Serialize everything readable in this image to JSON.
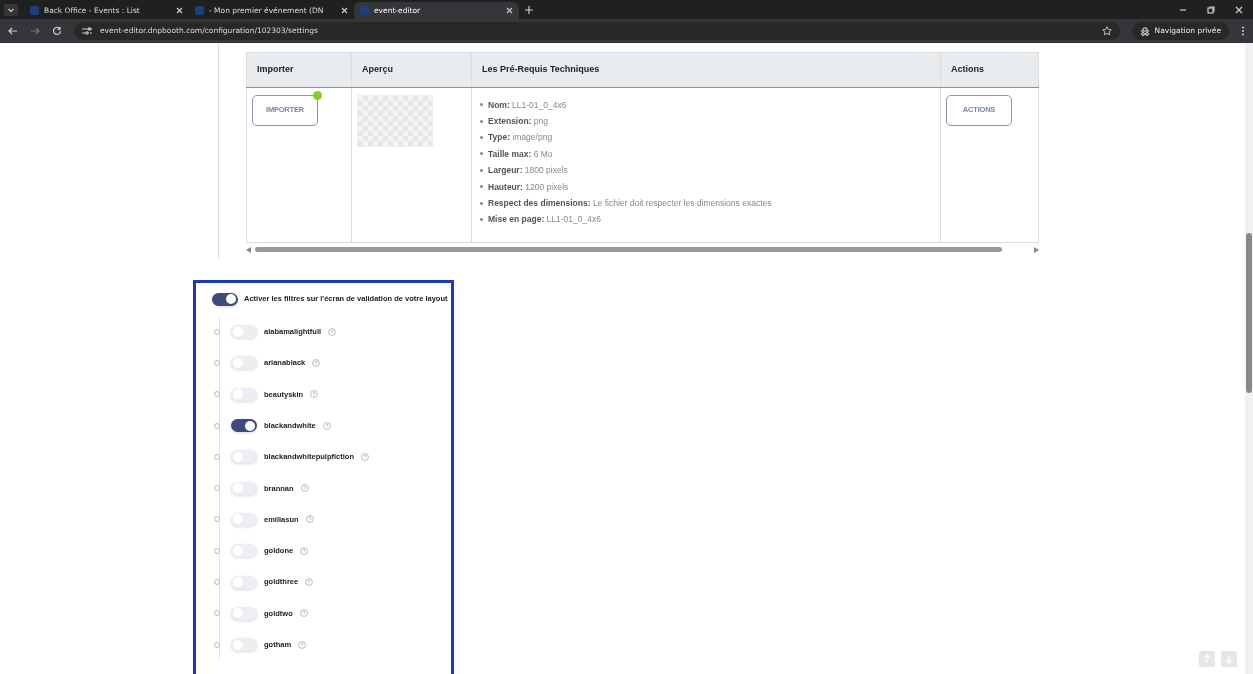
{
  "browser": {
    "tabs": [
      {
        "title": "Back Office - Events : List",
        "selected": false
      },
      {
        "title": "- Mon premier événement (DN",
        "selected": false
      },
      {
        "title": "event-editor",
        "selected": true
      }
    ],
    "url": "event-editor.dnpbooth.com/configuration/102303/settings",
    "private_label": "Navigation privée"
  },
  "table": {
    "columns": [
      "Importer",
      "Aperçu",
      "Les Pré-Requis Techniques",
      "Actions"
    ],
    "rows": [
      {
        "import_button": "IMPORTER",
        "actions_button": "ACTIONS",
        "requirements": [
          "**Nom:** LL1-01_0_4x6",
          "**Extension:** png",
          "**Type:** image/png",
          "**Taille max:** 6 Mo",
          "**Largeur:** 1800 pixels",
          "**Hauteur:** 1200 pixels",
          "**Respect des dimensions:** Le fichier doit respecter les dimensions exactes",
          "**Mise en page:** LL1-01_0_4x6"
        ]
      }
    ]
  },
  "filters": {
    "master": {
      "label": "Activer les filtres sur l'écran de validation de votre layout",
      "on": true
    },
    "items": [
      {
        "name": "alabamalightfull",
        "on": false
      },
      {
        "name": "arianablack",
        "on": false
      },
      {
        "name": "beautyskin",
        "on": false
      },
      {
        "name": "blackandwhite",
        "on": true
      },
      {
        "name": "blackandwhitepulpfiction",
        "on": false
      },
      {
        "name": "brannan",
        "on": false
      },
      {
        "name": "emillasun",
        "on": false
      },
      {
        "name": "goldone",
        "on": false
      },
      {
        "name": "goldthree",
        "on": false
      },
      {
        "name": "goldtwo",
        "on": false
      },
      {
        "name": "gotham",
        "on": false
      }
    ]
  }
}
